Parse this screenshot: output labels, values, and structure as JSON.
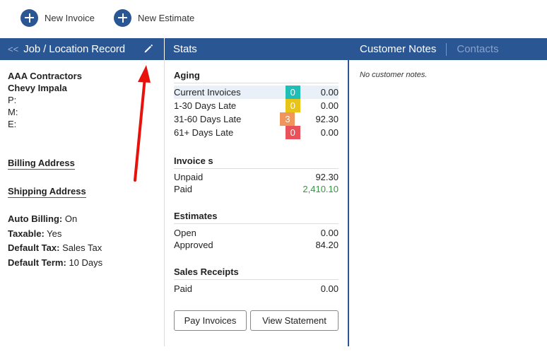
{
  "toolbar": {
    "new_invoice": "New Invoice",
    "new_estimate": "New Estimate"
  },
  "header": {
    "back": "<<",
    "record_title": "Job / Location Record",
    "stats_title": "Stats",
    "tabs": [
      {
        "label": "Customer Notes",
        "active": true
      },
      {
        "label": "Contacts",
        "active": false
      }
    ]
  },
  "record": {
    "company": "AAA Contractors",
    "job": "Chevy Impala",
    "phone_label": "P:",
    "mobile_label": "M:",
    "email_label": "E:",
    "billing_address": "Billing Address",
    "shipping_address": "Shipping Address",
    "settings": [
      {
        "label": "Auto Billing:",
        "value": "On"
      },
      {
        "label": "Taxable:",
        "value": "Yes"
      },
      {
        "label": "Default Tax:",
        "value": "Sales Tax"
      },
      {
        "label": "Default Term:",
        "value": "10 Days"
      }
    ]
  },
  "stats": {
    "aging": {
      "heading": "Aging",
      "rows": [
        {
          "name": "Current Invoices",
          "count": "0",
          "amount": "0.00",
          "color": "#1fbfb8"
        },
        {
          "name": "1-30 Days Late",
          "count": "0",
          "amount": "0.00",
          "color": "#e8c41a"
        },
        {
          "name": "31-60 Days Late",
          "count": "3",
          "amount": "92.30",
          "color": "#f0955b"
        },
        {
          "name": "61+ Days Late",
          "count": "0",
          "amount": "0.00",
          "color": "#e8525a"
        }
      ]
    },
    "invoices": {
      "heading": "Invoice s",
      "rows": [
        {
          "name": "Unpaid",
          "amount": "92.30"
        },
        {
          "name": "Paid",
          "amount": "2,410.10"
        }
      ]
    },
    "estimates": {
      "heading": "Estimates",
      "rows": [
        {
          "name": "Open",
          "amount": "0.00"
        },
        {
          "name": "Approved",
          "amount": "84.20"
        }
      ]
    },
    "receipts": {
      "heading": "Sales Receipts",
      "rows": [
        {
          "name": "Paid",
          "amount": "0.00"
        }
      ]
    },
    "pay_invoices": "Pay Invoices",
    "view_statement": "View Statement"
  },
  "notes": {
    "empty": "No customer notes."
  },
  "colors": {
    "brand": "#2b5694",
    "paid_green": "#2e9a3c",
    "annotation_arrow": "#e8120c"
  },
  "icons": [
    "plus-circle-icon",
    "pencil-icon",
    "annotation-arrow"
  ]
}
